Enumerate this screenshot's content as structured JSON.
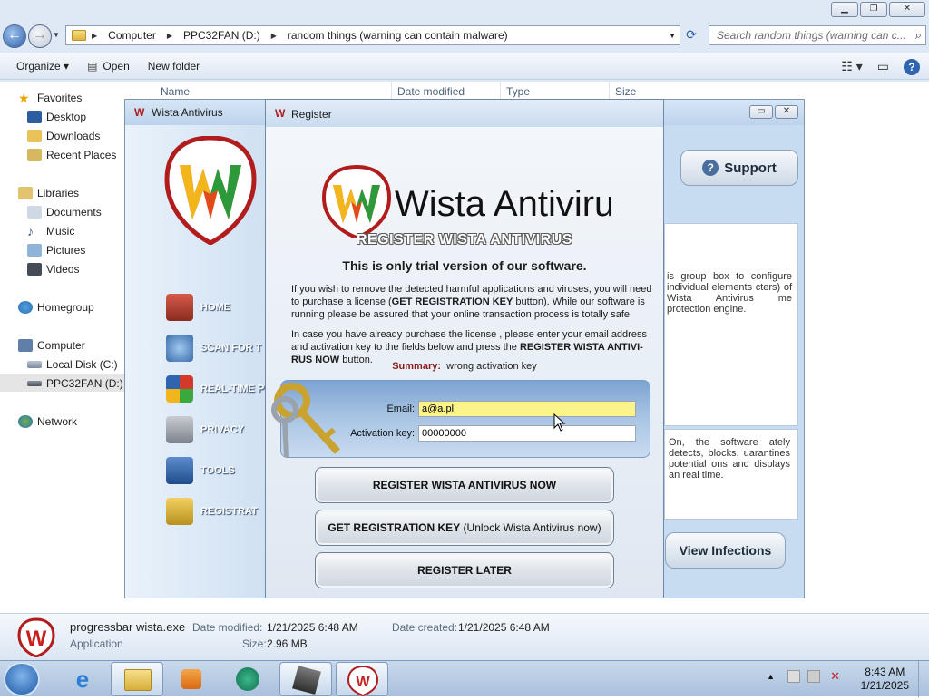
{
  "explorer": {
    "address": {
      "segments": [
        "Computer",
        "PPC32FAN (D:)",
        "random things (warning can contain malware)"
      ]
    },
    "search": {
      "placeholder": "Search random things (warning can c..."
    },
    "toolbar": {
      "organize": "Organize ▾",
      "open": "Open",
      "new_folder": "New folder"
    },
    "columns": {
      "name": "Name",
      "date_modified": "Date modified",
      "type": "Type",
      "size": "Size"
    },
    "nav": {
      "favorites": "Favorites",
      "desktop": "Desktop",
      "downloads": "Downloads",
      "recent_places": "Recent Places",
      "libraries": "Libraries",
      "documents": "Documents",
      "music": "Music",
      "pictures": "Pictures",
      "videos": "Videos",
      "homegroup": "Homegroup",
      "computer": "Computer",
      "local_disk": "Local Disk (C:)",
      "ppc32fan": "PPC32FAN (D:)",
      "network": "Network"
    },
    "details": {
      "filename": "progressbar wista.exe",
      "filetype": "Application",
      "date_modified_label": "Date modified:",
      "date_modified": "1/21/2025 6:48 AM",
      "date_created_label": "Date created:",
      "date_created": "1/21/2025 6:48 AM",
      "size_label": "Size:",
      "size": "2.96 MB"
    }
  },
  "wista": {
    "title": "Wista Antivirus",
    "menu": [
      "HOME",
      "SCAN FOR T",
      "REAL-TIME P",
      "PRIVACY",
      "TOOLS",
      "REGISTRAT"
    ],
    "support": "Support",
    "panel1_text": "is group box to configure individual elements cters) of Wista Antivirus me protection engine.",
    "panel2_text": "On, the software ately detects, blocks, uarantines potential ons and displays an real time.",
    "view_infections": "View Infections"
  },
  "dialog": {
    "title": "Register",
    "brand": "Wista Antivirus",
    "heading": "REGISTER WISTA ANTIVIRUS",
    "trial": "This is only trial version of our software.",
    "para1_a": "If you wish to remove the detected harmful applications and viruses, you will need to purchase a license (",
    "para1_b": "GET REGISTRATION KEY",
    "para1_c": " button). While our software is running please be assured that your online transaction process is totally safe.",
    "para2_a": "In case  you have already purchase the license , please enter your email address and activation key  to the fields below and press the ",
    "para2_b": "REGISTER WISTA ANTIVI-RUS NOW",
    "para2_c": " button.",
    "summary_label": "Summary:",
    "summary_value": "wrong activation key",
    "email_label": "Email:",
    "email_value": "a@a.pl",
    "key_label": "Activation key:",
    "key_value": "00000000",
    "btn_register_now": "REGISTER WISTA ANTIVIRUS NOW",
    "btn_get_key_bold": "GET REGISTRATION KEY",
    "btn_get_key_rest": " (Unlock Wista Antivirus now)",
    "btn_later": "REGISTER LATER"
  },
  "taskbar": {
    "time": "8:43 AM",
    "date": "1/21/2025"
  },
  "colors": {
    "email_highlight": "#fbf48a",
    "summary_label": "#8a1a1a",
    "accent": "#2b5fa8"
  }
}
